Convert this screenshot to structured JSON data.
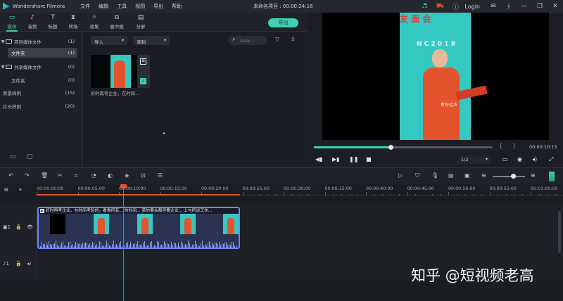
{
  "titlebar": {
    "app_name": "Wondershare Filmora",
    "menu": [
      "文件",
      "编辑",
      "工具",
      "视图",
      "导出",
      "帮助"
    ],
    "project_title": "未命名项目 : 00:00:24:16",
    "login": "Login"
  },
  "toolbar": {
    "tabs": [
      {
        "label": "媒体",
        "icon": "folder-icon"
      },
      {
        "label": "音频",
        "icon": "music-icon"
      },
      {
        "label": "标题",
        "icon": "text-icon"
      },
      {
        "label": "转场",
        "icon": "transition-icon"
      },
      {
        "label": "效果",
        "icon": "effects-icon"
      },
      {
        "label": "画中画",
        "icon": "pip-icon"
      },
      {
        "label": "分屏",
        "icon": "split-screen-icon"
      }
    ],
    "export_label": "导出"
  },
  "sidebar": {
    "items": [
      {
        "label": "项目媒体文件",
        "count": "(1)"
      },
      {
        "label": "文件夹",
        "count": "(1)"
      },
      {
        "label": "共享媒体文件",
        "count": "(0)"
      },
      {
        "label": "文件夹",
        "count": "(0)"
      },
      {
        "label": "背景样例",
        "count": "(15)"
      },
      {
        "label": "片头样例",
        "count": "(20)"
      }
    ]
  },
  "media": {
    "import_label": "导入",
    "record_label": "录制",
    "search_placeholder": "Sear...",
    "thumb_caption": "好时再考企业，在时间..."
  },
  "preview": {
    "video_text_1": "友  面 会",
    "video_text_2": "N C 2 0 1 8",
    "subtitle": "有好企业",
    "progress": 0.43,
    "time": "00:00:10:15",
    "nav_prev": "{",
    "nav_next": "}",
    "quality": "1/2"
  },
  "timeline": {
    "ticks": [
      "00:00:00:00",
      "00:00:05:00",
      "00:00:10:00",
      "00:00:15:00",
      "00:00:20:00",
      "00:00:25:00",
      "00:00:30:00",
      "00:00:35:00",
      "00:00:40:00",
      "00:00:45:00",
      "00:00:50:00",
      "00:00:55:00",
      "00:01:00:00"
    ],
    "clip_title": "好时再考企业，在时间考验的，看看所有... 的时间... 荣的要会都但要企业... 上与所谈工作..."
  },
  "watermark": "知乎 @短视频老高",
  "colors": {
    "accent": "#3fd1b3",
    "playhead": "#e0562f",
    "clip_border": "#6f87ff"
  }
}
